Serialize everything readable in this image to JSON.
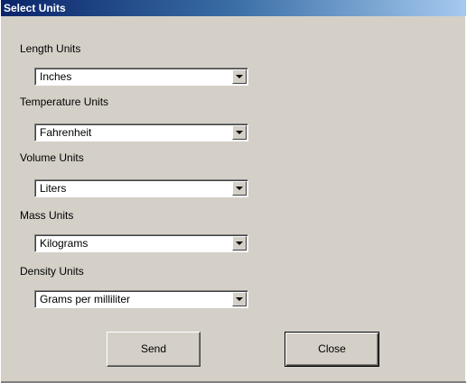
{
  "window": {
    "title": "Select Units"
  },
  "fields": {
    "length": {
      "label": "Length Units",
      "value": "Inches"
    },
    "temperature": {
      "label": "Temperature Units",
      "value": "Fahrenheit"
    },
    "volume": {
      "label": "Volume Units",
      "value": "Liters"
    },
    "mass": {
      "label": "Mass Units",
      "value": "Kilograms"
    },
    "density": {
      "label": "Density Units",
      "value": "Grams per milliliter"
    }
  },
  "buttons": {
    "send": "Send",
    "close": "Close"
  },
  "icons": {
    "dropdown": "chevron-down-icon"
  },
  "colors": {
    "title_bar_start": "#0a246a",
    "title_bar_end": "#a6caf0",
    "dialog_background": "#d4d0c8"
  }
}
